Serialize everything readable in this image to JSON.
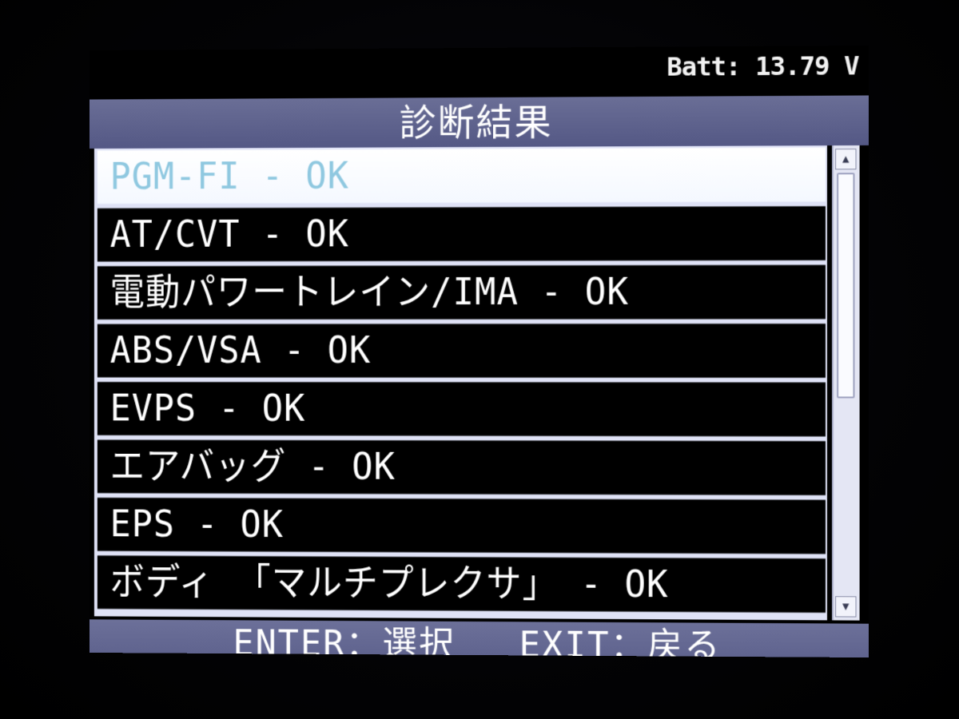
{
  "status_bar": {
    "battery": "Batt: 13.79 V"
  },
  "header": {
    "title": "診断結果"
  },
  "results": [
    {
      "label": "PGM-FI - OK",
      "selected": true
    },
    {
      "label": "AT/CVT - OK",
      "selected": false
    },
    {
      "label": "電動パワートレイン/IMA - OK",
      "selected": false
    },
    {
      "label": "ABS/VSA - OK",
      "selected": false
    },
    {
      "label": "EVPS - OK",
      "selected": false
    },
    {
      "label": "エアバッグ - OK",
      "selected": false
    },
    {
      "label": "EPS - OK",
      "selected": false
    },
    {
      "label": "ボディ 「マルチプレクサ」 - OK",
      "selected": false
    }
  ],
  "scrollbar": {
    "up_icon": "triangle-up-icon",
    "down_icon": "triangle-down-icon"
  },
  "footer": {
    "enter_hint": "ENTER：選択",
    "exit_hint": "EXIT：戻る"
  },
  "colors": {
    "title_bar": "#5e6290",
    "row_background": "#000000",
    "selected_row": "#ffffff",
    "selected_text": "#8fc8e0"
  }
}
